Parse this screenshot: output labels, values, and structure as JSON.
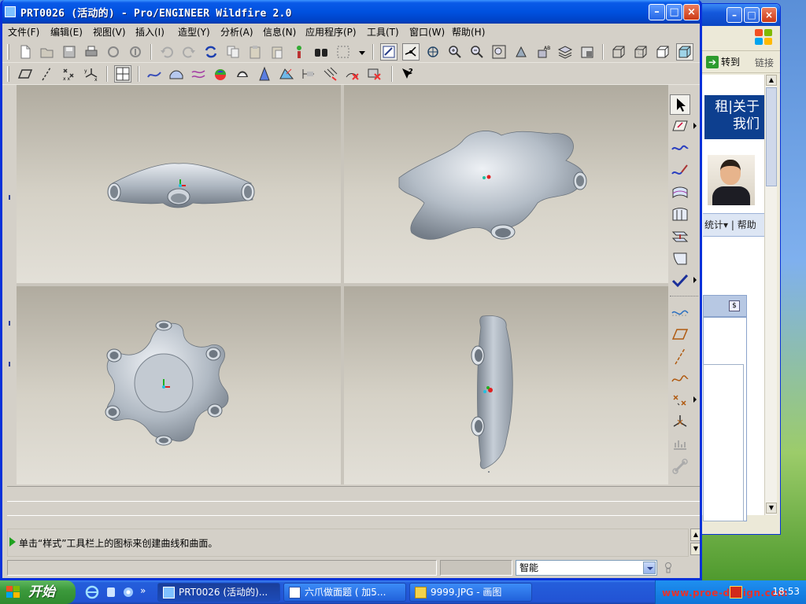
{
  "window": {
    "title": "PRT0026 (活动的) - Pro/ENGINEER Wildfire 2.0"
  },
  "menu": [
    "文件(F)",
    "编辑(E)",
    "视图(V)",
    "插入(I)",
    "造型(Y)",
    "分析(A)",
    "信息(N)",
    "应用程序(P)",
    "工具(T)",
    "窗口(W)",
    "帮助(H)"
  ],
  "message": {
    "prompt": "单击“样式”工具栏上的图标来创建曲线和曲面。"
  },
  "status": {
    "filter_value": "智能"
  },
  "background_window": {
    "goto_label": "转到",
    "links_label": "链接",
    "banner_line1": "租|关于",
    "banner_line2": "我们",
    "subnav_label": "统计▾ | 帮助"
  },
  "taskbar": {
    "start_label": "开始",
    "tasks": [
      "PRT0026 (活动的)...",
      "六爪做面题 ( 加5...",
      "9999.JPG - 画图"
    ],
    "watermark": "www.proe-design.com",
    "clock": "18:53"
  },
  "colors": {
    "title_bar": "#0051df",
    "viewport_top": "#b0ab9f",
    "viewport_bottom": "#e3e0d8",
    "model_fill": "#b4bcc6",
    "csys_red": "#e02020",
    "csys_green": "#20b020",
    "prompt_arrow": "#1fa11f"
  },
  "icons": {
    "window_buttons": [
      "minimize-icon",
      "maximize-icon",
      "close-icon"
    ],
    "toolbar_top": [
      "new-icon",
      "open-icon",
      "save-icon",
      "print-icon",
      "send-mail-icon",
      "mail-recipient-icon",
      "undo-icon",
      "redo-icon",
      "regenerate-icon",
      "copy-icon",
      "paste-icon",
      "paste-special-icon",
      "model-player-icon",
      "find-icon",
      "select-box-icon",
      "redraw-icon",
      "spin-center-icon",
      "orient-mode-icon",
      "zoom-in-icon",
      "zoom-out-icon",
      "refit-icon",
      "reorient-icon",
      "saved-views-icon",
      "layers-icon",
      "view-manager-icon",
      "wireframe-icon",
      "hidden-line-icon",
      "no-hidden-icon",
      "shading-icon"
    ],
    "toolbar_second": [
      "datum-plane-icon",
      "datum-axis-icon",
      "datum-point-icon",
      "csys-icon",
      "four-views-icon",
      "sketch-curve-icon",
      "surface-icon",
      "curve-edit-icon",
      "color-map-icon",
      "shading-analysis-icon",
      "draft-icon",
      "reflection-icon",
      "section-icon",
      "dihedral-icon",
      "delete-icon",
      "trim-icon",
      "whats-this-icon"
    ],
    "right_toolbar": [
      "select-arrow-icon",
      "active-plane-icon",
      "curve-icon",
      "curve-edit-icon",
      "surface-icon",
      "surface-edit-icon",
      "connect-icon",
      "trim-surface-icon",
      "done-check-icon",
      "datum-curve-icon",
      "plane-icon",
      "axis-icon",
      "sketch-icon",
      "point-icon",
      "csys-icon",
      "analysis-icon",
      "link-icon"
    ]
  }
}
